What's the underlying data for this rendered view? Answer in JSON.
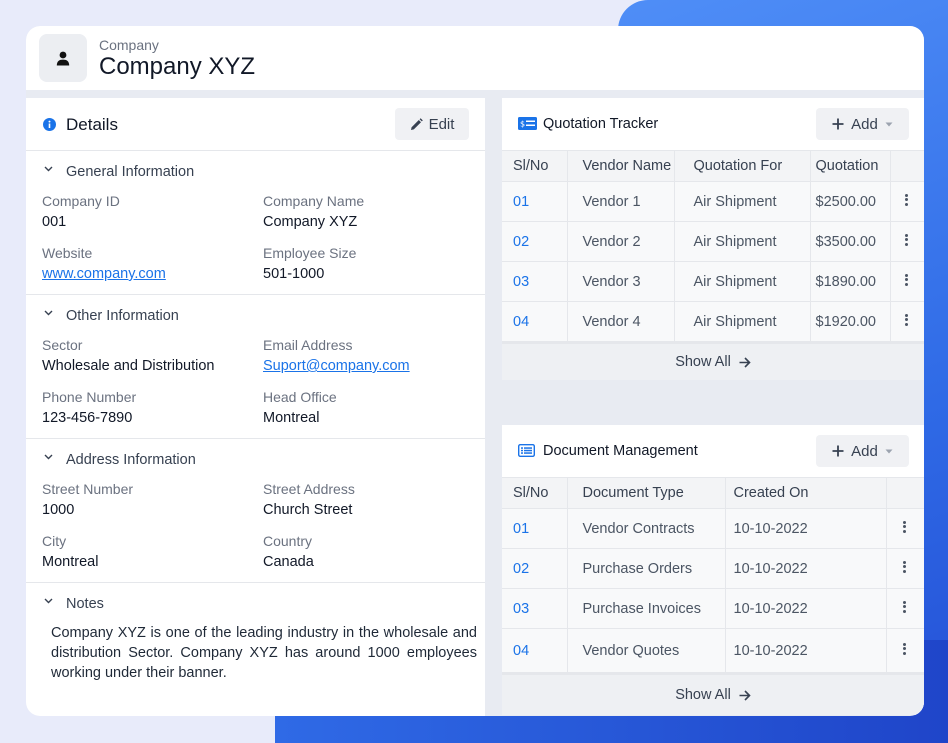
{
  "header": {
    "subtitle": "Company",
    "title": "Company XYZ"
  },
  "details": {
    "title": "Details",
    "edit_label": "Edit",
    "general": {
      "title": "General Information",
      "company_id_label": "Company ID",
      "company_id": "001",
      "company_name_label": "Company Name",
      "company_name": "Company XYZ",
      "website_label": "Website",
      "website": "www.company.com",
      "employee_size_label": "Employee Size",
      "employee_size": "501-1000"
    },
    "other": {
      "title": "Other Information",
      "sector_label": "Sector",
      "sector": "Wholesale and Distribution",
      "email_label": "Email Address",
      "email": "Suport@company.com",
      "phone_label": "Phone Number",
      "phone": "123-456-7890",
      "head_office_label": "Head Office",
      "head_office": "Montreal"
    },
    "address": {
      "title": "Address Information",
      "street_number_label": "Street Number",
      "street_number": "1000",
      "street_address_label": "Street Address",
      "street_address": "Church Street",
      "city_label": "City",
      "city": "Montreal",
      "country_label": "Country",
      "country": "Canada"
    },
    "notes": {
      "title": "Notes",
      "text": "Company XYZ is one of the leading industry in the wholesale and distribution Sector. Company XYZ has around 1000 employees working under their banner."
    }
  },
  "quotation": {
    "title": "Quotation Tracker",
    "add_label": "Add",
    "columns": [
      "Sl/No",
      "Vendor Name",
      "Quotation For",
      "Quotation"
    ],
    "rows": [
      [
        "01",
        "Vendor 1",
        "Air Shipment",
        "$2500.00"
      ],
      [
        "02",
        "Vendor 2",
        "Air Shipment",
        "$3500.00"
      ],
      [
        "03",
        "Vendor 3",
        "Air Shipment",
        "$1890.00"
      ],
      [
        "04",
        "Vendor 4",
        "Air Shipment",
        "$1920.00"
      ]
    ],
    "show_all": "Show All"
  },
  "documents": {
    "title": "Document Management",
    "add_label": "Add",
    "columns": [
      "Sl/No",
      "Document Type",
      "Created On"
    ],
    "rows": [
      [
        "01",
        "Vendor Contracts",
        "10-10-2022"
      ],
      [
        "02",
        "Purchase Orders",
        "10-10-2022"
      ],
      [
        "03",
        "Purchase Invoices",
        "10-10-2022"
      ],
      [
        "04",
        "Vendor Quotes",
        "10-10-2022"
      ]
    ],
    "show_all": "Show All"
  },
  "colors": {
    "accent": "#1a73e8",
    "background": "#e8ebfa",
    "brand_blue": "#2563eb"
  }
}
